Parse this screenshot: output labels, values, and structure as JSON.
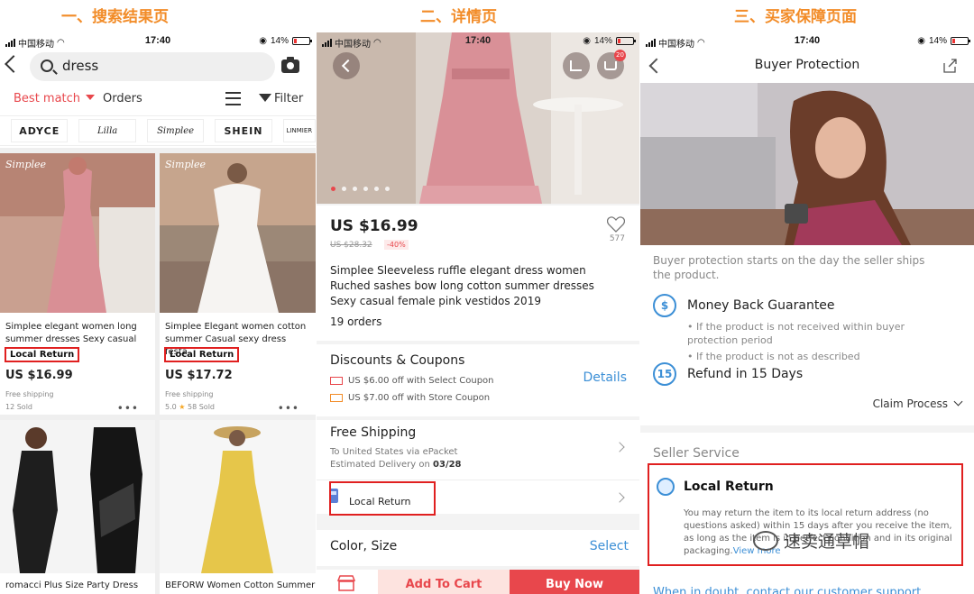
{
  "section_titles": [
    "一、搜索结果页",
    "二、详情页",
    "三、买家保障页面"
  ],
  "status_bar": {
    "carrier": "中国移动",
    "time": "17:40",
    "battery": "14%"
  },
  "search": {
    "query": "dress",
    "sort_label": "Best match",
    "orders_label": "Orders",
    "filter_label": "Filter",
    "brands": [
      "ADYCE",
      "Lilla",
      "Simplee",
      "SHEIN",
      "LINMIER"
    ],
    "products": [
      {
        "title": "Simplee elegant women long summer dresses Sexy casual",
        "badge": "Local Return",
        "price": "US $16.99",
        "shipping": "Free shipping",
        "sold": "12 Sold",
        "rating": "",
        "brand": "Simplee"
      },
      {
        "title": "Simplee Elegant women cotton summer Casual sexy dress festa",
        "badge": "Local Return",
        "price": "US $17.72",
        "shipping": "Free shipping",
        "sold": "58 Sold",
        "rating": "5.0",
        "brand": "Simplee"
      },
      {
        "title": "romacci Plus Size Party Dress"
      },
      {
        "title": "BEFORW Women Cotton Summer"
      }
    ]
  },
  "detail": {
    "cart_count": "20",
    "price": "US $16.99",
    "old_price": "US $28.32",
    "discount": "-40%",
    "wishlist_count": "577",
    "title": "Simplee Sleeveless ruffle elegant dress women Ruched sashes bow long cotton summer dresses Sexy casual female pink vestidos 2019",
    "orders": "19 orders",
    "coupons_heading": "Discounts & Coupons",
    "coupons": [
      "US $6.00 off with Select Coupon",
      "US $7.00 off with Store Coupon"
    ],
    "details_link": "Details",
    "shipping_heading": "Free Shipping",
    "shipping_to": "To United States via ePacket",
    "delivery_label": "Estimated Delivery on",
    "delivery_date": "03/28",
    "local_return": "Local Return",
    "color_size": "Color, Size",
    "select": "Select",
    "add_to_cart": "Add To Cart",
    "buy_now": "Buy Now"
  },
  "protection": {
    "title": "Buyer Protection",
    "intro": "Buyer protection starts on the day the seller ships the product.",
    "money_back": "Money Back Guarantee",
    "bullets": [
      "• If the product is not received within buyer protection period",
      "• If the product is not as described"
    ],
    "refund_days": "15",
    "refund": "Refund in 15 Days",
    "claim": "Claim Process",
    "seller_service": "Seller Service",
    "local_return": "Local Return",
    "local_return_desc": "You may return the item to its local return address (no questions asked) within 15 days after you receive the item, as long as the item is in perfect condition and in its original packaging.",
    "view_more": "View more",
    "watermark": "速卖通草帽",
    "help": "When in doubt, contact our customer support"
  },
  "colors": {
    "accent_red": "#e8474c",
    "link_blue": "#3c8fd6",
    "title_orange": "#f28c28",
    "highlight_box": "#e02020"
  }
}
